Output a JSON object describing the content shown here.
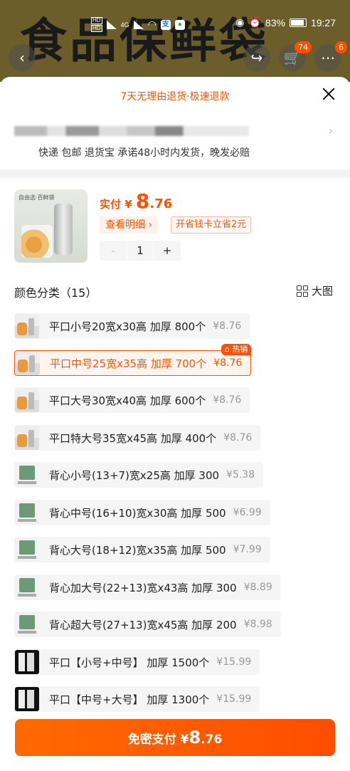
{
  "background": {
    "title": "食品保鲜袋"
  },
  "status_bar": {
    "hd1": "HD",
    "hd2": "HD",
    "net": "4G",
    "battery": "83%",
    "time": "19:27"
  },
  "nav": {
    "back": "‹",
    "share": "↪",
    "cart_badge": "74",
    "more_badge": "6"
  },
  "sheet": {
    "banner": "7天无理由退货·极速退款",
    "delivery": "快递 包邮 退货宝 承诺48小时内发货，晚发必赔"
  },
  "product": {
    "img_label": "自由选·百鲜袋",
    "price_label": "实付 ¥ ",
    "price_int": "8",
    "price_dec": ".76",
    "detail_btn": "查看明细 ›",
    "card_btn": "开省钱卡立省2元",
    "qty": "1",
    "minus": "-",
    "plus": "+"
  },
  "options": {
    "header": "颜色分类（15）",
    "bigimg_label": "大图",
    "hot_badge": "⌂ 热销",
    "items": [
      {
        "name": "平口小号20宽x30高 加厚 800个",
        "price": "¥8.76"
      },
      {
        "name": "平口中号25宽x35高 加厚 700个",
        "price": "¥8.76"
      },
      {
        "name": "平口大号30宽x40高 加厚 600个",
        "price": "¥8.76"
      },
      {
        "name": "平口特大号35宽x45高 加厚 400个",
        "price": "¥8.76"
      },
      {
        "name": "背心小号(13+7)宽x25高 加厚 300",
        "price": "¥5.38"
      },
      {
        "name": "背心中号(16+10)宽x30高 加厚 500",
        "price": "¥6.99"
      },
      {
        "name": "背心大号(18+12)宽x35高 加厚 500",
        "price": "¥7.99"
      },
      {
        "name": "背心加大号(22+13)宽x43高 加厚 300",
        "price": "¥8.89"
      },
      {
        "name": "背心超大号(27+13)宽x45高 加厚 200",
        "price": "¥8.98"
      },
      {
        "name": "平口【小号+中号】 加厚 1500个",
        "price": "¥15.99"
      },
      {
        "name": "平口【中号+大号】 加厚 1300个",
        "price": "¥15.99"
      }
    ]
  },
  "pay": {
    "label": "免密支付 ¥",
    "int": "8",
    "dec": ".76"
  },
  "colors": {
    "accent": "#ff5000",
    "option_bg": "#f5f5f5"
  }
}
